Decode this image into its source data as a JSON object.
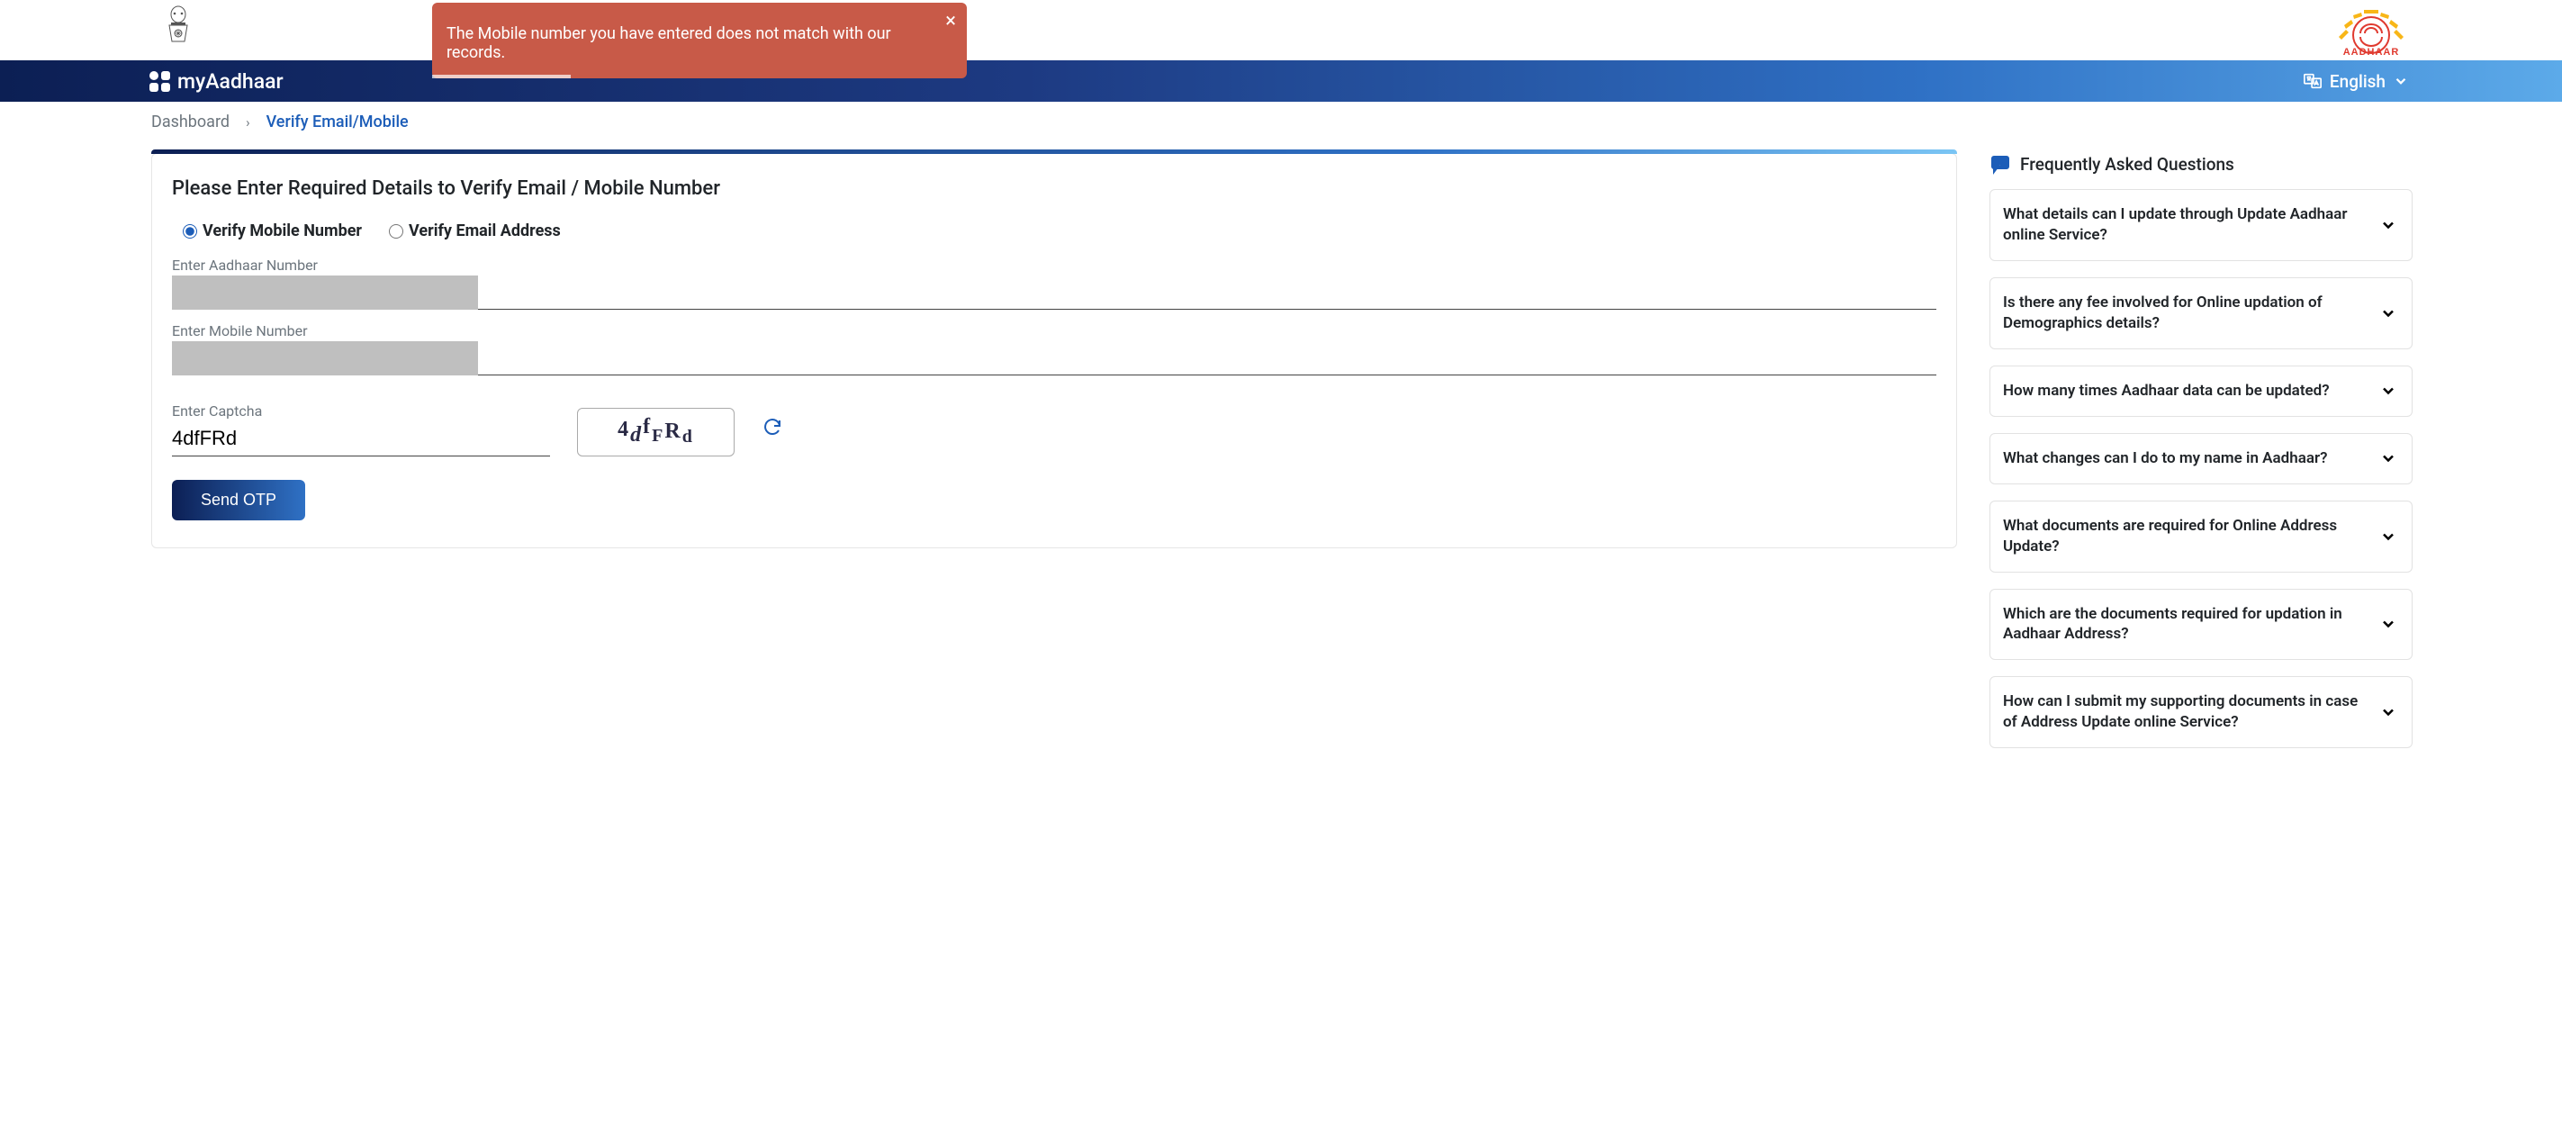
{
  "alert": {
    "message": "The Mobile number you have entered does not match with our records.",
    "close": "×"
  },
  "header": {
    "brand": "myAadhaar",
    "language": "English"
  },
  "breadcrumbs": {
    "root": "Dashboard",
    "separator": "›",
    "current": "Verify Email/Mobile"
  },
  "form": {
    "title": "Please Enter Required Details to Verify Email / Mobile Number",
    "radio_mobile": "Verify Mobile Number",
    "radio_email": "Verify Email Address",
    "label_aadhaar": "Enter Aadhaar Number",
    "label_mobile": "Enter Mobile Number",
    "label_captcha": "Enter Captcha",
    "captcha_value": "4dfFRd",
    "captcha_image_text": "4dfFRd",
    "button_send": "Send OTP"
  },
  "faq": {
    "title": "Frequently Asked Questions",
    "items": [
      "What details can I update through Update Aadhaar online Service?",
      "Is there any fee involved for Online updation of Demographics details?",
      "How many times Aadhaar data can be updated?",
      "What changes can I do to my name in Aadhaar?",
      "What documents are required for Online Address Update?",
      "Which are the documents required for updation in Aadhaar Address?",
      "How can I submit my supporting documents in case of Address Update online Service?"
    ]
  }
}
